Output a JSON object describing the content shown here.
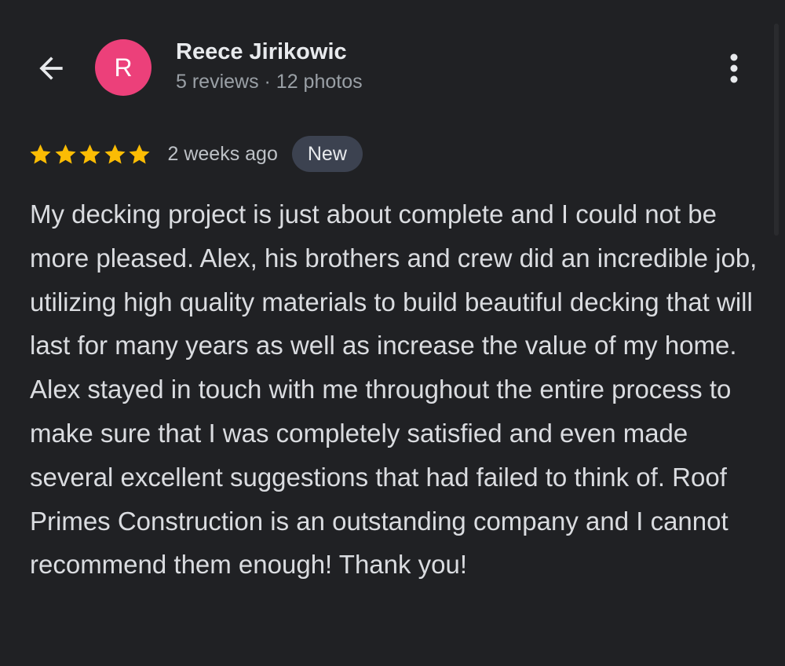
{
  "header": {
    "back_icon": "arrow-back-icon",
    "avatar_initial": "R",
    "avatar_color": "#ec407a",
    "reviewer_name": "Reece Jirikowic",
    "reviewer_meta": "5 reviews · 12 photos",
    "more_icon": "more-vert-icon"
  },
  "review": {
    "rating": 5,
    "rating_max": 5,
    "star_color": "#fbbc04",
    "date": "2 weeks ago",
    "badge": "New",
    "text": "My decking project is just about complete and I could not be more pleased. Alex, his brothers and crew did an incredible job, utilizing high quality materials to build beautiful decking that will last for many years as well as increase the value of my home. Alex stayed in touch with me throughout the entire process to make sure that I was completely satisfied and even made several excellent suggestions that had failed to think of. Roof Primes Construction is an outstanding company and I cannot recommend them enough! Thank you!"
  }
}
